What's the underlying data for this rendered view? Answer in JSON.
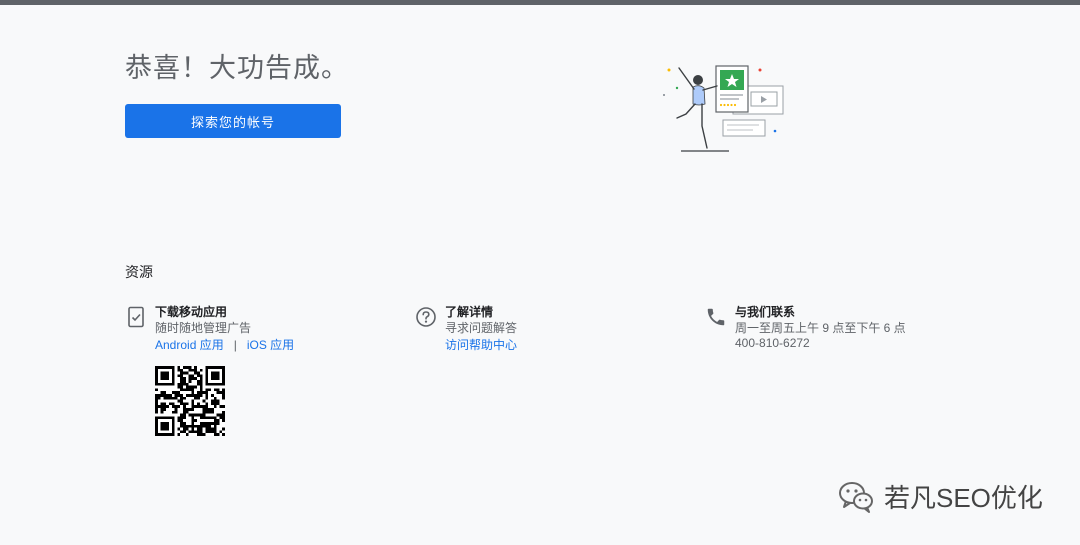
{
  "hero": {
    "title": "恭喜！大功告成。",
    "cta_label": "探索您的帐号"
  },
  "resources": {
    "title": "资源",
    "mobile": {
      "title": "下载移动应用",
      "desc": "随时随地管理广告",
      "android_label": "Android 应用",
      "separator": "|",
      "ios_label": "iOS 应用",
      "icon": "mobile-phone-icon"
    },
    "help": {
      "title": "了解详情",
      "desc": "寻求问题解答",
      "link": "访问帮助中心",
      "icon": "help-circle-icon"
    },
    "contact": {
      "title": "与我们联系",
      "hours": "周一至周五上午 9 点至下午 6 点",
      "phone": "400-810-6272",
      "icon": "phone-icon"
    }
  },
  "watermark": {
    "text": "若凡SEO优化"
  },
  "colors": {
    "primary": "#1a73e8",
    "background": "#f8f9fa",
    "text": "#3c4043",
    "accent_green": "#34a853"
  }
}
